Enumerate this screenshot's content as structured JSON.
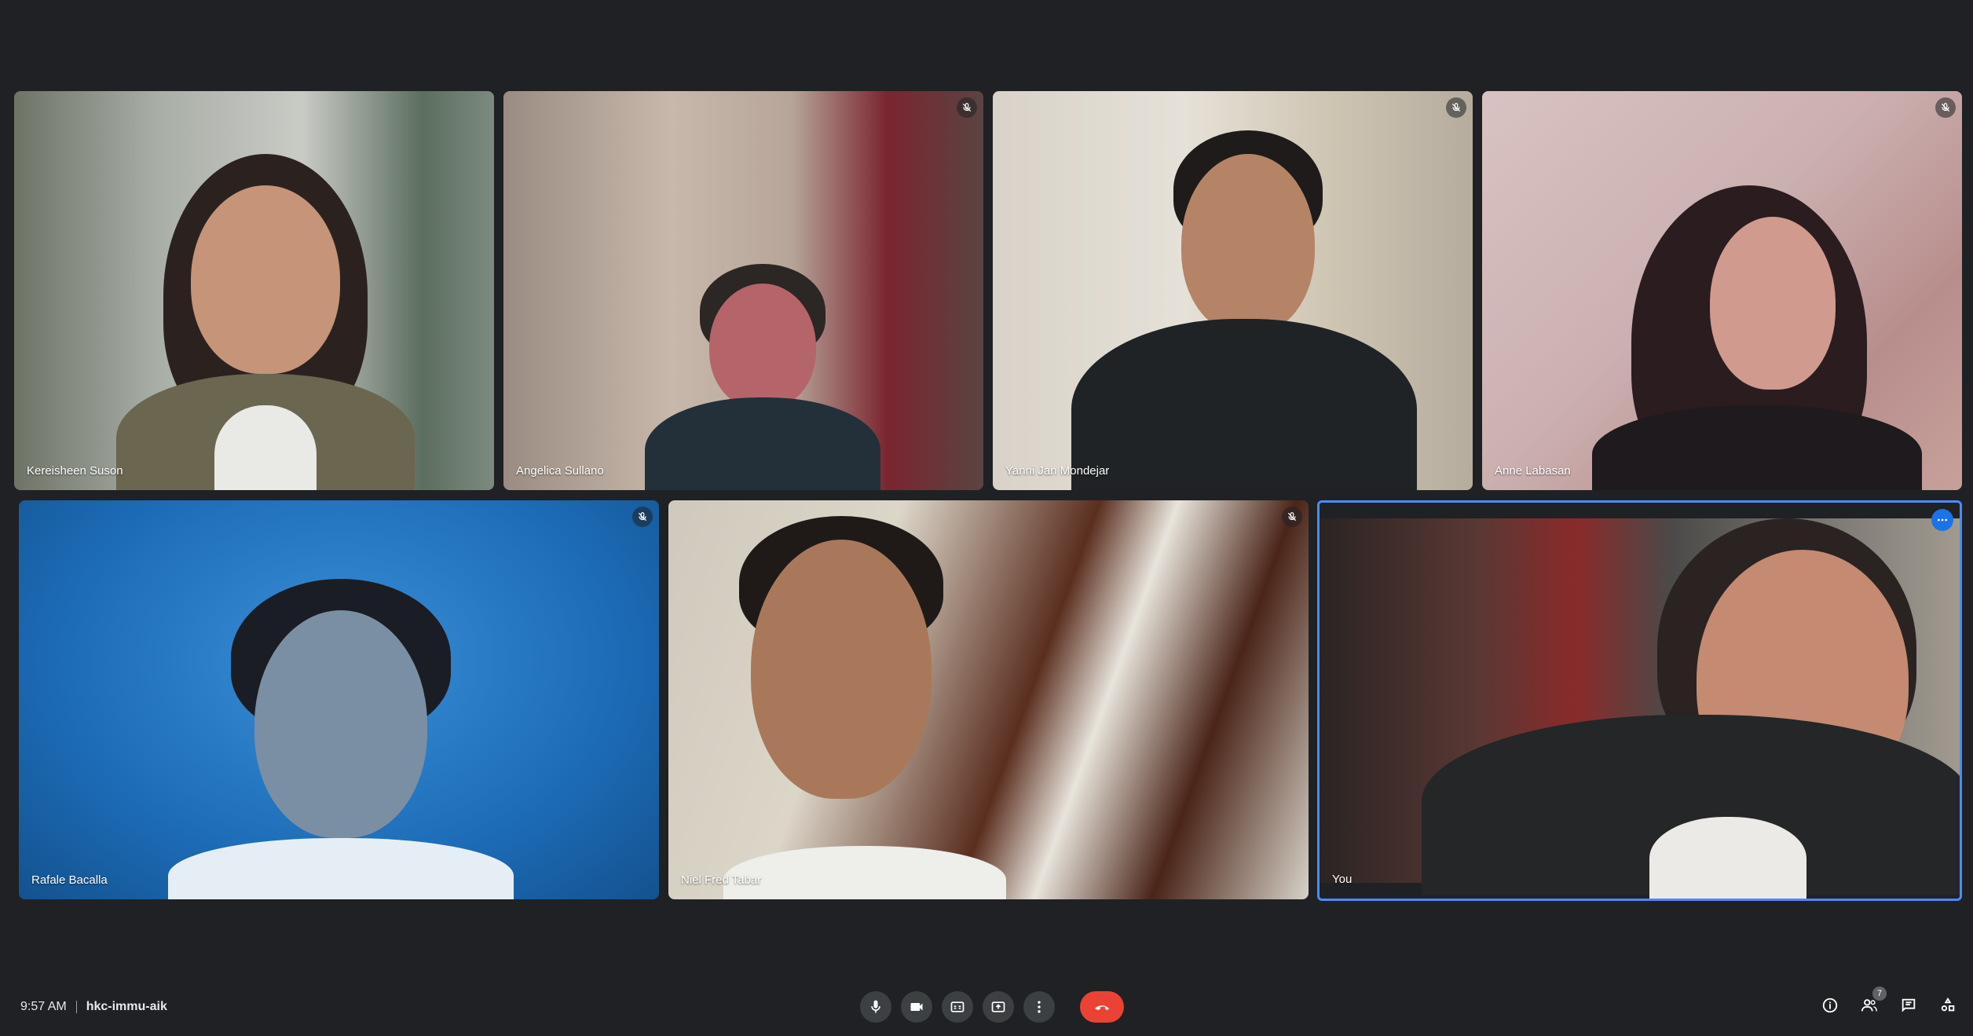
{
  "meeting": {
    "time": "9:57 AM",
    "code": "hkc-immu-aik"
  },
  "participants": [
    {
      "name": "Kereisheen Suson",
      "muted": false
    },
    {
      "name": "Angelica Sullano",
      "muted": true
    },
    {
      "name": "Yanni Jan Mondejar",
      "muted": true
    },
    {
      "name": "Anne Labasan",
      "muted": true
    },
    {
      "name": "Rafale Bacalla",
      "muted": true
    },
    {
      "name": "Niel Fred Tabar",
      "muted": true
    },
    {
      "name": "You",
      "muted": false
    }
  ],
  "participant_count": "7",
  "controls": [
    "microphone-icon",
    "camera-icon",
    "captions-icon",
    "present-icon",
    "more-options-icon",
    "end-call-icon"
  ],
  "right_icons": [
    "meeting-details-icon",
    "people-icon",
    "chat-icon",
    "activities-icon"
  ],
  "colors": {
    "background": "#202124",
    "end_call": "#ea4335",
    "self_border": "#4c8bf5",
    "control_bg": "#3c4043"
  }
}
